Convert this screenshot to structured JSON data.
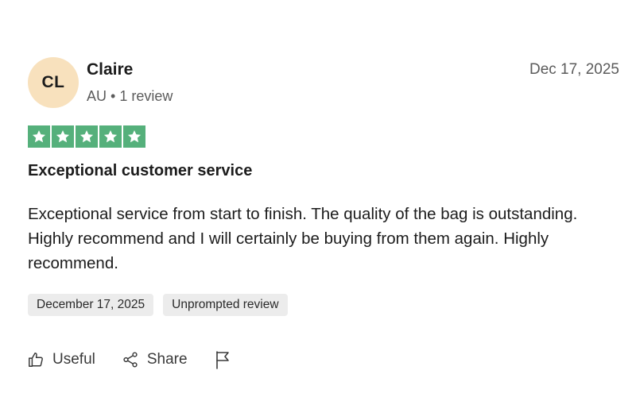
{
  "reviewer": {
    "initials": "CL",
    "name": "Claire",
    "country": "AU",
    "separator": "•",
    "review_count": "1 review",
    "avatar_color": "#f8e1bd"
  },
  "review": {
    "date": "Dec 17, 2025",
    "rating": 5,
    "rating_max": 5,
    "star_color": "#55b07b",
    "title": "Exceptional customer service",
    "body": "Exceptional service from start to finish. The quality of the bag is outstanding. Highly recommend and I will certainly be buying from them again. Highly recommend.",
    "tags": [
      "December 17, 2025",
      "Unprompted review"
    ]
  },
  "actions": {
    "useful_label": "Useful",
    "useful_icon": "thumbs-up-icon",
    "share_label": "Share",
    "share_icon": "share-icon",
    "report_icon": "flag-icon"
  }
}
